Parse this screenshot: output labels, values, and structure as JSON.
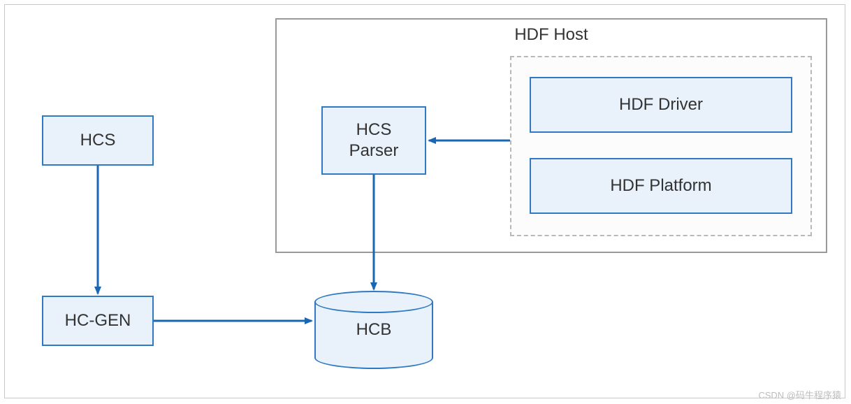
{
  "nodes": {
    "hcs": "HCS",
    "hcgen": "HC-GEN",
    "hcb": "HCB",
    "hcs_parser": "HCS\nParser",
    "hdf_driver": "HDF Driver",
    "hdf_platform": "HDF Platform"
  },
  "containers": {
    "hdf_host_title": "HDF Host"
  },
  "watermark": "CSDN @码牛程序猿"
}
